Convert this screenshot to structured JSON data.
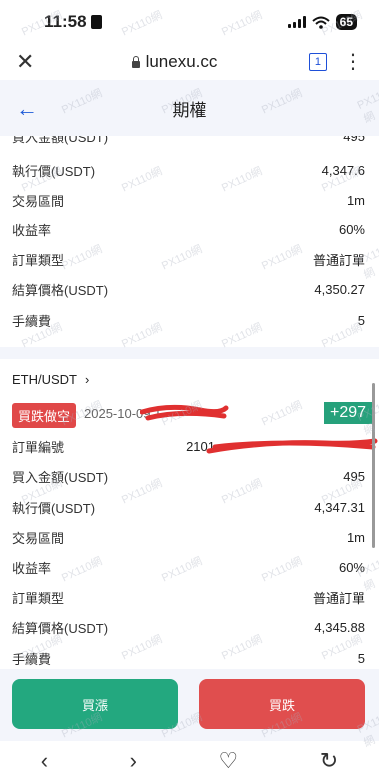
{
  "status": {
    "time": "11:58",
    "battery": "65"
  },
  "browser": {
    "url": "lunexu.cc",
    "tab_count": "1"
  },
  "app": {
    "title": "期權"
  },
  "order1": {
    "partial_label": "買入金額(USDT)",
    "partial_value": "495",
    "rows": [
      {
        "label": "執行價(USDT)",
        "value": "4,347.6"
      },
      {
        "label": "交易區間",
        "value": "1m"
      },
      {
        "label": "收益率",
        "value": "60%"
      },
      {
        "label": "訂單類型",
        "value": "普通訂單"
      },
      {
        "label": "結算價格(USDT)",
        "value": "4,350.27"
      },
      {
        "label": "手續費",
        "value": "5"
      }
    ]
  },
  "order2": {
    "pair": "ETH/USDT",
    "side": "買跌做空",
    "date": "2025-10-09 1",
    "pnl": "+297",
    "order_no_label": "訂單編號",
    "order_no_value": "2101",
    "rows": [
      {
        "label": "買入金額(USDT)",
        "value": "495"
      },
      {
        "label": "執行價(USDT)",
        "value": "4,347.31"
      },
      {
        "label": "交易區間",
        "value": "1m"
      },
      {
        "label": "收益率",
        "value": "60%"
      },
      {
        "label": "訂單類型",
        "value": "普通訂單"
      },
      {
        "label": "結算價格(USDT)",
        "value": "4,345.88"
      },
      {
        "label": "手續費",
        "value": "5"
      }
    ]
  },
  "actions": {
    "buy_up": "買漲",
    "buy_down": "買跌"
  },
  "watermark_text": "PX110網",
  "colors": {
    "accent_blue": "#1e5bd8",
    "buy_green": "#23a87f",
    "sell_red": "#e04e4e",
    "bg_light": "#f3f5fb"
  },
  "icons": {
    "close": "close-icon",
    "back": "arrow-left-icon",
    "chevron": "chevron-right-icon",
    "nav": [
      "chevron-left-icon",
      "chevron-right-icon",
      "heart-icon",
      "reload-icon"
    ]
  }
}
